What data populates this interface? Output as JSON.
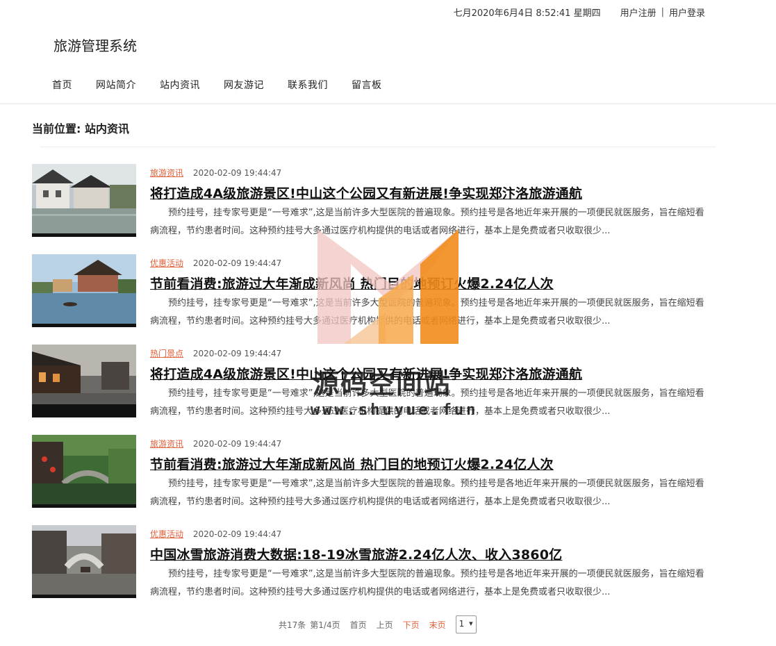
{
  "header": {
    "datetime": "七月2020年6月4日 8:52:41 星期四",
    "register_label": "用户注册",
    "separator": "|",
    "login_label": "用户登录",
    "site_title": "旅游管理系统"
  },
  "nav": {
    "items": [
      "首页",
      "网站简介",
      "站内资讯",
      "网友游记",
      "联系我们",
      "留言板"
    ]
  },
  "breadcrumb": "当前位置: 站内资讯",
  "articles": [
    {
      "category": "旅游资讯",
      "date": "2020-02-09 19:44:47",
      "title": "将打造成4A级旅游景区!中山这个公园又有新进展!争实现郑汴洛旅游通航",
      "summary": "预约挂号，挂专家号更是“一号难求”,这是当前许多大型医院的普遍现象。预约挂号是各地近年来开展的一项便民就医服务，旨在缩短看病流程，节约患者时间。这种预约挂号大多通过医疗机构提供的电话或者网络进行，基本上是免费或者只收取很少..."
    },
    {
      "category": "优惠活动",
      "date": "2020-02-09 19:44:47",
      "title": "节前看消费:旅游过大年渐成新风尚 热门目的地预订火爆2.24亿人次",
      "summary": "预约挂号，挂专家号更是“一号难求”,这是当前许多大型医院的普遍现象。预约挂号是各地近年来开展的一项便民就医服务，旨在缩短看病流程，节约患者时间。这种预约挂号大多通过医疗机构提供的电话或者网络进行，基本上是免费或者只收取很少..."
    },
    {
      "category": "热门景点",
      "date": "2020-02-09 19:44:47",
      "title": "将打造成4A级旅游景区!中山这个公园又有新进展!争实现郑汴洛旅游通航",
      "summary": "预约挂号，挂专家号更是“一号难求”,这是当前许多大型医院的普遍现象。预约挂号是各地近年来开展的一项便民就医服务，旨在缩短看病流程，节约患者时间。这种预约挂号大多通过医疗机构提供的电话或者网络进行，基本上是免费或者只收取很少..."
    },
    {
      "category": "旅游资讯",
      "date": "2020-02-09 19:44:47",
      "title": "节前看消费:旅游过大年渐成新风尚 热门目的地预订火爆2.24亿人次",
      "summary": "预约挂号，挂专家号更是“一号难求”,这是当前许多大型医院的普遍现象。预约挂号是各地近年来开展的一项便民就医服务，旨在缩短看病流程，节约患者时间。这种预约挂号大多通过医疗机构提供的电话或者网络进行，基本上是免费或者只收取很少..."
    },
    {
      "category": "优惠活动",
      "date": "2020-02-09 19:44:47",
      "title": "中国冰雪旅游消费大数据:18-19冰雪旅游2.24亿人次、收入3860亿",
      "summary": "预约挂号，挂专家号更是“一号难求”,这是当前许多大型医院的普遍现象。预约挂号是各地近年来开展的一项便民就医服务，旨在缩短看病流程，节约患者时间。这种预约挂号大多通过医疗机构提供的电话或者网络进行，基本上是免费或者只收取很少..."
    }
  ],
  "pager": {
    "total": "共17条",
    "page_info": "第1/4页",
    "first": "首页",
    "prev": "上页",
    "next": "下页",
    "last": "末页",
    "selected_page": "1"
  },
  "watermark": {
    "title": "源码空间站",
    "url": "www.shuyue.fun"
  },
  "colors": {
    "accent": "#e2603c",
    "watermark_orange": "#f39a2c",
    "watermark_pink": "#f1c4c0"
  }
}
